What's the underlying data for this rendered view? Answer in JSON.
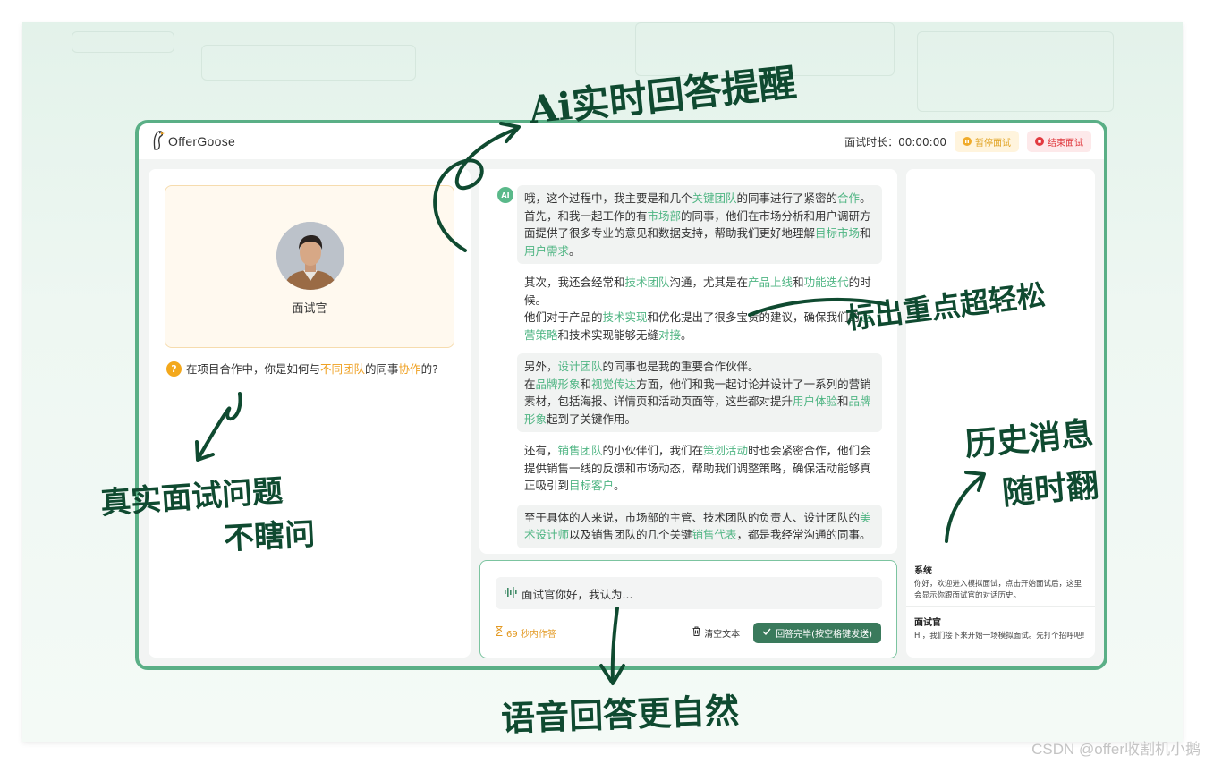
{
  "app": {
    "logo_text": "OfferGoose",
    "timer_label": "面试时长：00:00:00",
    "pause_label": "暂停面试",
    "end_label": "结束面试"
  },
  "interviewer": {
    "name": "面试官",
    "question_parts": [
      "在项目合作中，你是如何与",
      "不同团队",
      "的同事",
      "协作",
      "的?"
    ]
  },
  "conversation": {
    "ai_badge": "AI",
    "messages": [
      {
        "shaded": true,
        "segments": [
          {
            "t": "哦，这个过程中，我主要是和几个"
          },
          {
            "t": "关键团队",
            "h": true
          },
          {
            "t": "的同事进行了紧密的"
          },
          {
            "t": "合作",
            "h": true
          },
          {
            "t": "。",
            "br": true
          },
          {
            "t": "首先，和我一起工作的有"
          },
          {
            "t": "市场部",
            "h": true
          },
          {
            "t": "的同事，他们在市场分析和用户调研方面提供了很多专业的意见和数据支持，帮助我们更好地理解"
          },
          {
            "t": "目标市场",
            "h": true
          },
          {
            "t": "和"
          },
          {
            "t": "用户需求",
            "h": true
          },
          {
            "t": "。"
          }
        ]
      },
      {
        "shaded": false,
        "segments": [
          {
            "t": "其次，我还会经常和"
          },
          {
            "t": "技术团队",
            "h": true
          },
          {
            "t": "沟通，尤其是在"
          },
          {
            "t": "产品上线",
            "h": true
          },
          {
            "t": "和"
          },
          {
            "t": "功能迭代",
            "h": true
          },
          {
            "t": "的时候。",
            "br": true
          },
          {
            "t": "他们对于产品的"
          },
          {
            "t": "技术实现",
            "h": true
          },
          {
            "t": "和优化提出了很多宝贵的建议，确保我们的"
          },
          {
            "t": "运营策略",
            "h": true
          },
          {
            "t": "和技术实现能够无缝"
          },
          {
            "t": "对接",
            "h": true
          },
          {
            "t": "。"
          }
        ]
      },
      {
        "shaded": true,
        "segments": [
          {
            "t": "另外，"
          },
          {
            "t": "设计团队",
            "h": true
          },
          {
            "t": "的同事也是我的重要合作伙伴。",
            "br": true
          },
          {
            "t": "在"
          },
          {
            "t": "品牌形象",
            "h": true
          },
          {
            "t": "和"
          },
          {
            "t": "视觉传达",
            "h": true
          },
          {
            "t": "方面，他们和我一起讨论并设计了一系列的营销素材，包括海报、详情页和活动页面等，这些都对提升"
          },
          {
            "t": "用户体验",
            "h": true
          },
          {
            "t": "和"
          },
          {
            "t": "品牌形象",
            "h": true
          },
          {
            "t": "起到了关键作用。"
          }
        ]
      },
      {
        "shaded": false,
        "segments": [
          {
            "t": "还有，"
          },
          {
            "t": "销售团队",
            "h": true
          },
          {
            "t": "的小伙伴们，我们在"
          },
          {
            "t": "策划活动",
            "h": true
          },
          {
            "t": "时也会紧密合作，他们会提供销售一线的反馈和市场动态，帮助我们调整策略，确保活动能够真正吸引到"
          },
          {
            "t": "目标客户",
            "h": true
          },
          {
            "t": "。"
          }
        ]
      },
      {
        "shaded": true,
        "segments": [
          {
            "t": "至于具体的人来说，市场部的主管、技术团队的负责人、设计团队的"
          },
          {
            "t": "美术设计师",
            "h": true
          },
          {
            "t": "以及销售团队的几个关键"
          },
          {
            "t": "销售代表",
            "h": true
          },
          {
            "t": "，都是我经常沟通的同事。"
          }
        ]
      }
    ]
  },
  "answer": {
    "input_value": "面试官你好，我认为...",
    "countdown": "69 秒内作答",
    "clear_label": "清空文本",
    "submit_label": "回答完毕(按空格键发送)"
  },
  "history": [
    {
      "title": "系统",
      "text": "你好，欢迎进入模拟面试，点击开始面试后，这里会显示你跟面试官的对话历史。"
    },
    {
      "title": "面试官",
      "text": "Hi，我们接下来开始一场模拟面试。先打个招呼吧!"
    }
  ],
  "annotations": {
    "ai_hint": "Ai实时回答提醒",
    "highlight": "标出重点超轻松",
    "real_question": "真实面试问题",
    "no_blind_guess": "不瞎问",
    "history_msg": "历史消息",
    "flip_anytime": "随时翻",
    "voice_answer": "语音回答更自然"
  },
  "watermark": "CSDN @offer收割机小鹅",
  "colors": {
    "brand_green": "#5aaf86",
    "highlight_green": "#4fb583",
    "highlight_orange": "#efa123",
    "annotation_ink": "#0f4a30"
  }
}
